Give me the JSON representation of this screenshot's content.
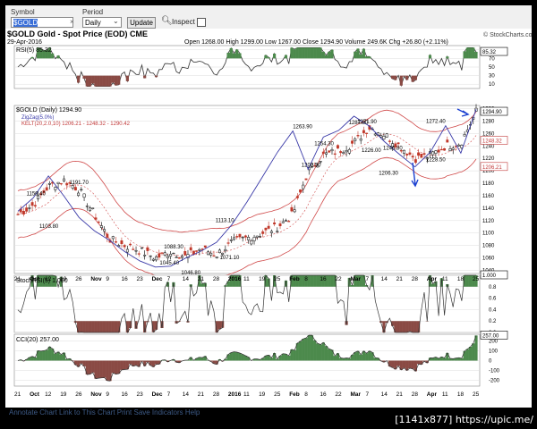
{
  "toolbar": {
    "symbol_label": "Symbol",
    "symbol_value": "$GOLD",
    "period_label": "Period",
    "period_value": "Daily",
    "update_label": "Update",
    "inspect_label": "Inspect"
  },
  "header": {
    "title": "$GOLD Gold - Spot Price (EOD) CME",
    "date": "29-Apr-2016",
    "brand": "© StockCharts.com",
    "ohlc": "Open 1268.00  High 1299.00  Low 1267.00  Close 1294.90  Volume 249.6K  Chg +26.80 (+2.11%)"
  },
  "rsi": {
    "label": "RSI(5) 85.32",
    "current": "85.32",
    "ticks": [
      "90",
      "70",
      "50",
      "30",
      "10"
    ]
  },
  "price": {
    "legend_main": "$GOLD (Daily) 1294.90",
    "legend_zigzag": "ZigZag(5.0%)",
    "legend_kelt": "KELT(20,2.0,10) 1206.21 - 1248.32 - 1290.42",
    "price_box": "1294.90",
    "kelt_mid_box": "1248.32",
    "kelt_low_box": "1206.21",
    "ticks": [
      "1300",
      "1280",
      "1260",
      "1240",
      "1220",
      "1200",
      "1180",
      "1160",
      "1140",
      "1120",
      "1100",
      "1080",
      "1060",
      "1040"
    ],
    "annotations": [
      {
        "text": "1156.40",
        "p": 1156.4
      },
      {
        "text": "1191.70",
        "p": 1191.7
      },
      {
        "text": "1103.80",
        "p": 1103.8
      },
      {
        "text": "1088.30",
        "p": 1088.3
      },
      {
        "text": "1045.40",
        "p": 1045.4
      },
      {
        "text": "1046.80",
        "p": 1046.8
      },
      {
        "text": "1113.10",
        "p": 1113.1
      },
      {
        "text": "1071.10",
        "p": 1071.1
      },
      {
        "text": "1263.90",
        "p": 1263.9
      },
      {
        "text": "1254.30",
        "p": 1254.3
      },
      {
        "text": "1202.50",
        "p": 1202.5
      },
      {
        "text": "1287.80",
        "p": 1287.8
      },
      {
        "text": "1271.90",
        "p": 1271.9
      },
      {
        "text": "1246.80",
        "p": 1246.8
      },
      {
        "text": "1226.00",
        "p": 1226.0
      },
      {
        "text": "1206.30",
        "p": 1206.3
      },
      {
        "text": "1272.40",
        "p": 1272.4
      },
      {
        "text": "1228.50",
        "p": 1228.5
      }
    ]
  },
  "stochrsi": {
    "label": "StochRSI(5) 1.000",
    "current": "1.000",
    "ticks": [
      "1.0",
      "0.8",
      "0.6",
      "0.4",
      "0.2",
      "0.0"
    ]
  },
  "cci": {
    "label": "CCI(20) 257.00",
    "current": "257.00",
    "ticks": [
      "200",
      "100",
      "0",
      "-100",
      "-200"
    ]
  },
  "xaxis": {
    "labels": [
      "21",
      "Oct",
      "12",
      "19",
      "26",
      "Nov",
      "9",
      "16",
      "23",
      "Dec",
      "7",
      "14",
      "21",
      "28",
      "2016",
      "11",
      "19",
      "25",
      "Feb",
      "8",
      "16",
      "22",
      "Mar",
      "7",
      "14",
      "21",
      "28",
      "Apr",
      "11",
      "18",
      "25"
    ]
  },
  "bottom": {
    "links": "Annotate Chart   Link to This Chart   Print   Save   Indicators   Help",
    "badge": "[1141x877] https://upic.me/"
  },
  "chart_data": {
    "type": "line",
    "title": "$GOLD Gold - Spot Price (EOD) CME",
    "x": [
      "Sep 21",
      "Oct 1",
      "Oct 12",
      "Oct 19",
      "Oct 26",
      "Nov 2",
      "Nov 9",
      "Nov 16",
      "Nov 23",
      "Dec 1",
      "Dec 7",
      "Dec 14",
      "Dec 21",
      "Dec 28",
      "Jan 4",
      "Jan 11",
      "Jan 19",
      "Jan 25",
      "Feb 1",
      "Feb 8",
      "Feb 16",
      "Feb 22",
      "Mar 1",
      "Mar 7",
      "Mar 14",
      "Mar 21",
      "Mar 28",
      "Apr 4",
      "Apr 11",
      "Apr 18",
      "Apr 25"
    ],
    "series": [
      {
        "name": "$GOLD (Daily)",
        "values": [
          1130,
          1145,
          1175,
          1185,
          1170,
          1130,
          1090,
          1080,
          1072,
          1060,
          1070,
          1062,
          1075,
          1065,
          1085,
          1092,
          1100,
          1110,
          1130,
          1200,
          1225,
          1232,
          1245,
          1270,
          1258,
          1240,
          1220,
          1225,
          1240,
          1245,
          1294.9
        ]
      },
      {
        "name": "ZigZag(5.0%)",
        "values": [
          1135,
          1156.4,
          1191.7,
          1160,
          1125,
          1103.8,
          1088.3,
          1070,
          1055,
          1045.4,
          1046.8,
          1060,
          1071.1,
          1085,
          1113.1,
          1150,
          1190,
          1230,
          1263.9,
          1202.5,
          1254.3,
          1265,
          1287.8,
          1271.9,
          1246.8,
          1226.0,
          1206.3,
          1230,
          1272.4,
          1228.5,
          1299.0
        ]
      },
      {
        "name": "KELT",
        "values": [
          1170,
          1180,
          1200,
          1210,
          1200,
          1175,
          1140,
          1120,
          1105,
          1095,
          1095,
          1090,
          1095,
          1090,
          1100,
          1115,
          1130,
          1150,
          1170,
          1225,
          1250,
          1265,
          1275,
          1282,
          1280,
          1275,
          1265,
          1262,
          1268,
          1272,
          1290.42
        ]
      }
    ],
    "ylim": [
      1035,
      1305
    ]
  }
}
